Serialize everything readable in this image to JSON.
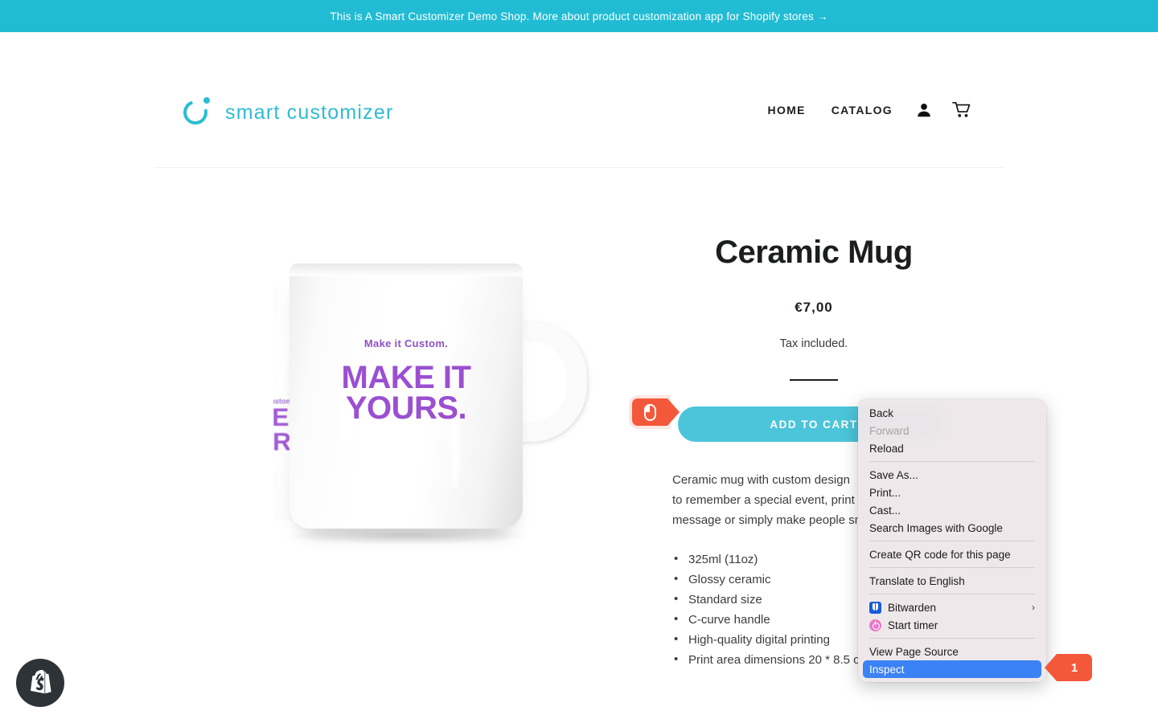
{
  "announcement": {
    "text": "This is A Smart Customizer Demo Shop. More about product customization app for Shopify stores →",
    "bg": "#21bcd4"
  },
  "header": {
    "logo_text": "smart customizer",
    "logo_color": "#2ebcd1",
    "nav": [
      {
        "label": "HOME",
        "name": "nav-home"
      },
      {
        "label": "CATALOG",
        "name": "nav-catalog"
      }
    ],
    "account_icon": "account-icon",
    "cart_icon": "cart-icon"
  },
  "gallery": {
    "mug_small_text": "Make it Custom.",
    "mug_big_line1": "MAKE IT",
    "mug_big_line2": "YOURS.",
    "art_color": "#9b4fd1"
  },
  "product": {
    "title": "Ceramic Mug",
    "price": "€7,00",
    "tax_note": "Tax included.",
    "add_to_cart": "ADD TO CART",
    "button_color": "#4cc5da",
    "description": [
      "Ceramic mug with custom design",
      "to remember a special event, print a",
      "message or simply make people smile."
    ],
    "features": [
      "325ml (11oz)",
      "Glossy ceramic",
      "Standard size",
      "C-curve handle",
      "High-quality digital printing",
      "Print area dimensions 20 * 8.5 cm"
    ]
  },
  "context_menu": {
    "items": [
      {
        "label": "Back",
        "state": "normal",
        "icon": null
      },
      {
        "label": "Forward",
        "state": "disabled",
        "icon": null
      },
      {
        "label": "Reload",
        "state": "normal",
        "icon": null
      },
      {
        "label": "Save As...",
        "state": "normal",
        "icon": null
      },
      {
        "label": "Print...",
        "state": "normal",
        "icon": null
      },
      {
        "label": "Cast...",
        "state": "normal",
        "icon": null
      },
      {
        "label": "Search Images with Google",
        "state": "normal",
        "icon": null
      },
      {
        "label": "Create QR code for this page",
        "state": "normal",
        "icon": null
      },
      {
        "label": "Translate to English",
        "state": "normal",
        "icon": null
      },
      {
        "label": "Bitwarden",
        "state": "normal",
        "icon": "bitwarden-icon",
        "submenu": true
      },
      {
        "label": "Start timer",
        "state": "normal",
        "icon": "timer-icon"
      },
      {
        "label": "View Page Source",
        "state": "normal",
        "icon": null
      },
      {
        "label": "Inspect",
        "state": "selected",
        "icon": null
      }
    ],
    "submenu_arrow": "›",
    "highlight_color": "#3b82f6"
  },
  "annotations": {
    "cursor_icon": "mouse-cursor-icon",
    "step_number": "1",
    "accent": "#f4583a"
  },
  "footer": {
    "shopify_badge": "shopify-logo-icon"
  }
}
